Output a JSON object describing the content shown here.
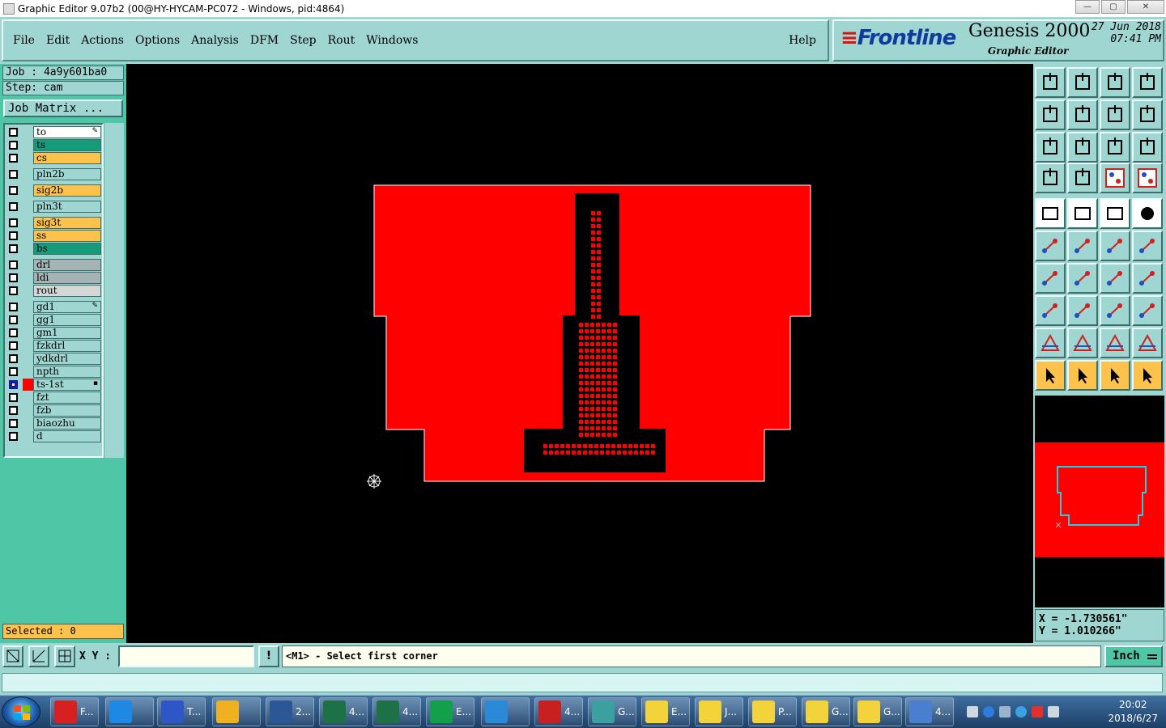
{
  "window": {
    "title": "Graphic Editor 9.07b2 (00@HY-HYCAM-PC072 - Windows, pid:4864)",
    "minimize": "—",
    "maximize": "▢",
    "close": "✕"
  },
  "menu": [
    "File",
    "Edit",
    "Actions",
    "Options",
    "Analysis",
    "DFM",
    "Step",
    "Rout",
    "Windows"
  ],
  "help": "Help",
  "brand": {
    "logo": "Frontline",
    "product": "Genesis 2000",
    "subtitle": "Graphic Editor",
    "date": "27 Jun 2018",
    "time": "07:41 PM"
  },
  "job": {
    "job_label": "Job : 4a9y601ba0",
    "step_label": "Step: cam",
    "matrix_button": "Job Matrix ..."
  },
  "layers": [
    {
      "name": "to",
      "color": "#ffffff",
      "mark": "✎"
    },
    {
      "name": "ts",
      "color": "#159a7a"
    },
    {
      "name": "cs",
      "color": "#fdc24c"
    },
    {
      "name": "pln2b",
      "color": "#9fd6d2"
    },
    {
      "name": "sig2b",
      "color": "#fdc24c"
    },
    {
      "name": "pln3t",
      "color": "#9fd6d2"
    },
    {
      "name": "sig3t",
      "color": "#fdc24c"
    },
    {
      "name": "ss",
      "color": "#fdc24c"
    },
    {
      "name": "bs",
      "color": "#159a7a"
    },
    {
      "name": "drl",
      "color": "#a6b3b5"
    },
    {
      "name": "ldi",
      "color": "#a6b3b5"
    },
    {
      "name": "rout",
      "color": "#d6d6d6"
    },
    {
      "name": "gd1",
      "color": "#9fd6d2",
      "mark": "✎"
    },
    {
      "name": "gg1",
      "color": "#9fd6d2"
    },
    {
      "name": "gm1",
      "color": "#9fd6d2"
    },
    {
      "name": "fzkdrl",
      "color": "#9fd6d2"
    },
    {
      "name": "ydkdrl",
      "color": "#9fd6d2"
    },
    {
      "name": "npth",
      "color": "#9fd6d2"
    },
    {
      "name": "ts-1st",
      "color": "#9fd6d2",
      "selected": true,
      "display_color": "#ff0000",
      "mark": "▪"
    },
    {
      "name": "fzt",
      "color": "#9fd6d2"
    },
    {
      "name": "fzb",
      "color": "#9fd6d2"
    },
    {
      "name": "biaozhu",
      "color": "#9fd6d2"
    },
    {
      "name": "d",
      "color": "#9fd6d2"
    }
  ],
  "selected_count": "Selected : 0",
  "coordinates": {
    "x": "X = -1.730561\"",
    "y": "Y = 1.010266\""
  },
  "command": {
    "xy_label": "X Y :",
    "xy_value": "",
    "alert": "!",
    "prompt": "<M1> - Select first corner",
    "unit": "Inch"
  },
  "taskbar": {
    "items": [
      {
        "label": "F...",
        "color": "#d82020"
      },
      {
        "label": "",
        "color": "#1e88e5"
      },
      {
        "label": "T...",
        "color": "#2f56c6"
      },
      {
        "label": "",
        "color": "#f0b020"
      },
      {
        "label": "2...",
        "color": "#2b5797"
      },
      {
        "label": "4...",
        "color": "#1e7145"
      },
      {
        "label": "4...",
        "color": "#1e7145"
      },
      {
        "label": "E...",
        "color": "#12a04a"
      },
      {
        "label": "",
        "color": "#2a8ad8"
      },
      {
        "label": "4...",
        "color": "#c82020"
      },
      {
        "label": "G...",
        "color": "#3aa0a0"
      },
      {
        "label": "E...",
        "color": "#f2d43a"
      },
      {
        "label": "J...",
        "color": "#f2d43a"
      },
      {
        "label": "P...",
        "color": "#f2d43a"
      },
      {
        "label": "G...",
        "color": "#f2d43a"
      },
      {
        "label": "G...",
        "color": "#f2d43a"
      },
      {
        "label": "4...",
        "color": "#4a7fd0"
      }
    ],
    "time": "20:02",
    "date": "2018/6/27"
  },
  "colors": {
    "panel": "#9fd6d2",
    "accent": "#4fc7a7",
    "board_fill": "#ff0000",
    "canvas": "#000000"
  }
}
